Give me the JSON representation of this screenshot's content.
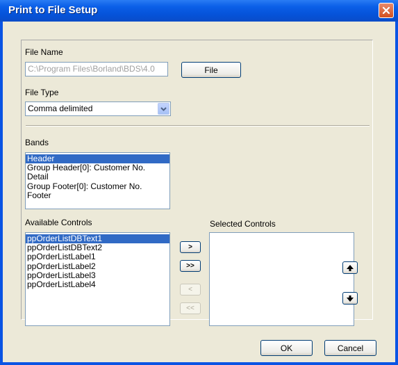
{
  "window": {
    "title": "Print to File Setup"
  },
  "file_name": {
    "label": "File Name",
    "value": "C:\\Program Files\\Borland\\BDS\\4.0",
    "button": "File"
  },
  "file_type": {
    "label": "File Type",
    "selected": "Comma delimited"
  },
  "bands": {
    "label": "Bands",
    "items": [
      "Header",
      "Group Header[0]: Customer No.",
      "Detail",
      "Group Footer[0]: Customer No.",
      "Footer"
    ],
    "selected_index": 0
  },
  "available_controls": {
    "label": "Available Controls",
    "items": [
      "ppOrderListDBText1",
      "ppOrderListDBText2",
      "ppOrderListLabel1",
      "ppOrderListLabel2",
      "ppOrderListLabel3",
      "ppOrderListLabel4"
    ],
    "selected_index": 0
  },
  "selected_controls": {
    "label": "Selected Controls",
    "items": []
  },
  "move_buttons": {
    "add": ">",
    "add_all": ">>",
    "remove": "<",
    "remove_all": "<<"
  },
  "footer": {
    "ok": "OK",
    "cancel": "Cancel"
  },
  "colors": {
    "title_bar": "#0a54e4",
    "selection": "#316ac5",
    "dialog_bg": "#ece9d8"
  }
}
